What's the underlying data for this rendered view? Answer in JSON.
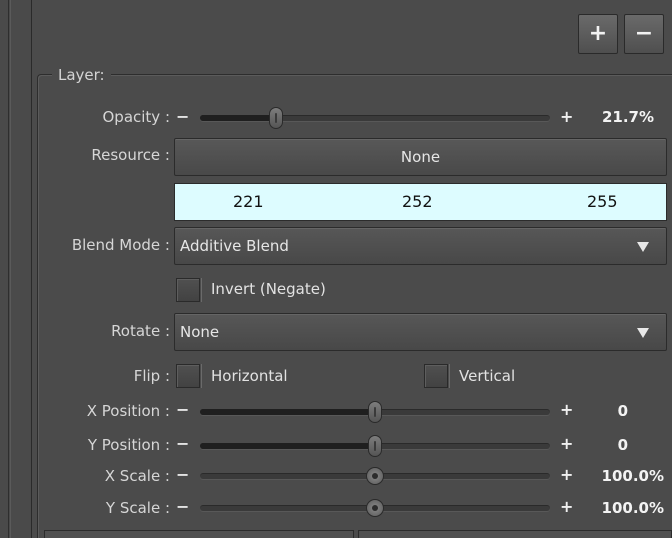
{
  "toolbar": {
    "add_label": "+",
    "remove_label": "−"
  },
  "layer": {
    "legend": "Layer:",
    "opacity": {
      "label": "Opacity :",
      "value": "21.7%",
      "fraction": 0.217
    },
    "resource": {
      "label": "Resource :",
      "value": "None"
    },
    "color": {
      "r": "221",
      "g": "252",
      "b": "255",
      "hex": "#ddfcff"
    },
    "blend_mode": {
      "label": "Blend Mode :",
      "value": "Additive Blend"
    },
    "invert": {
      "label": "Invert (Negate)",
      "checked": false
    },
    "rotate": {
      "label": "Rotate :",
      "value": "None"
    },
    "flip": {
      "label": "Flip :",
      "horizontal": "Horizontal",
      "vertical": "Vertical",
      "horizontal_checked": false,
      "vertical_checked": false
    },
    "x_position": {
      "label": "X Position :",
      "value": "0",
      "fraction": 0.5
    },
    "y_position": {
      "label": "Y Position :",
      "value": "0",
      "fraction": 0.5
    },
    "x_scale": {
      "label": "X Scale :",
      "value": "100.0%",
      "fraction": 0.5
    },
    "y_scale": {
      "label": "Y Scale :",
      "value": "100.0%",
      "fraction": 0.5
    },
    "minus_glyph": "−",
    "plus_glyph": "+"
  },
  "colors": {
    "panel": "#4b4b4b",
    "accent_color_box": "#ddfcff"
  }
}
